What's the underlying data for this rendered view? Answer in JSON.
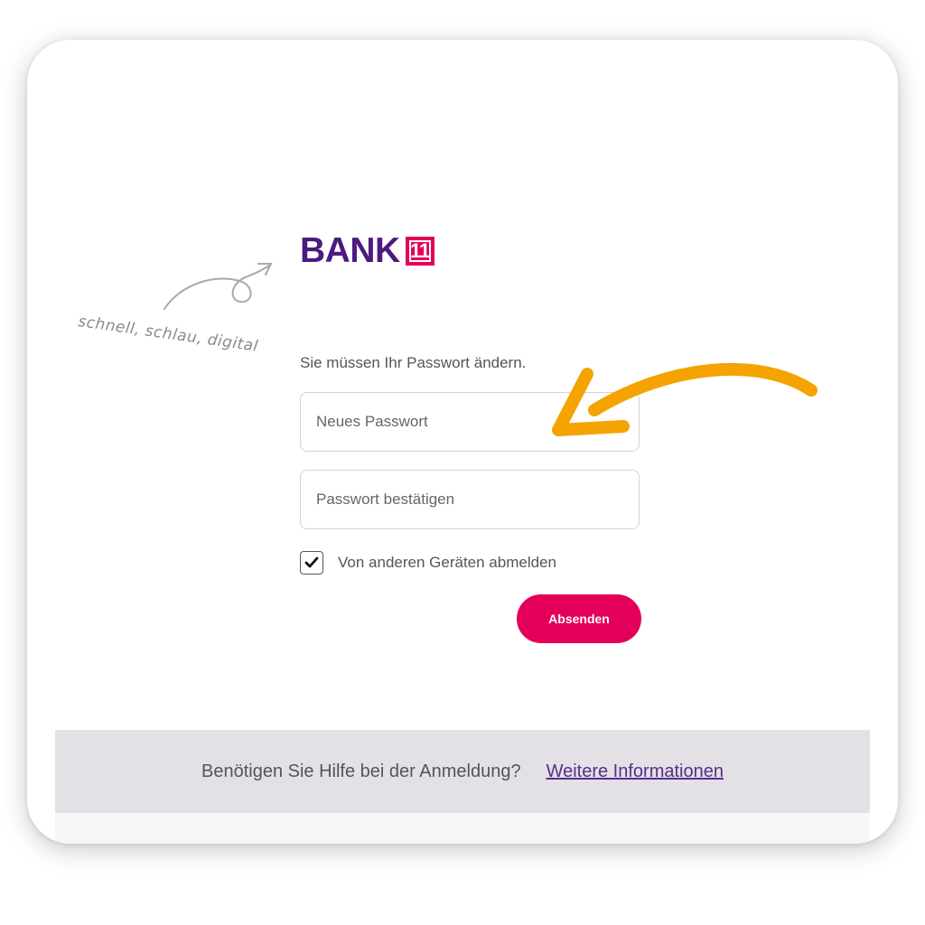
{
  "brand": {
    "name": "BANK",
    "badge": "11",
    "colors": {
      "purple": "#4d1a7f",
      "magenta": "#e4005a"
    }
  },
  "tagline": "schnell, schlau, digital",
  "form": {
    "prompt": "Sie müssen Ihr Passwort ändern.",
    "new_password_placeholder": "Neues Passwort",
    "confirm_password_placeholder": "Passwort bestätigen",
    "logout_checkbox": {
      "label": "Von anderen Geräten abmelden",
      "checked": true
    },
    "submit_label": "Absenden"
  },
  "help": {
    "text": "Benötigen Sie Hilfe bei der Anmeldung?",
    "link_label": "Weitere Informationen"
  },
  "annotation": {
    "icon": "arrow-icon",
    "color": "#f5a300"
  }
}
